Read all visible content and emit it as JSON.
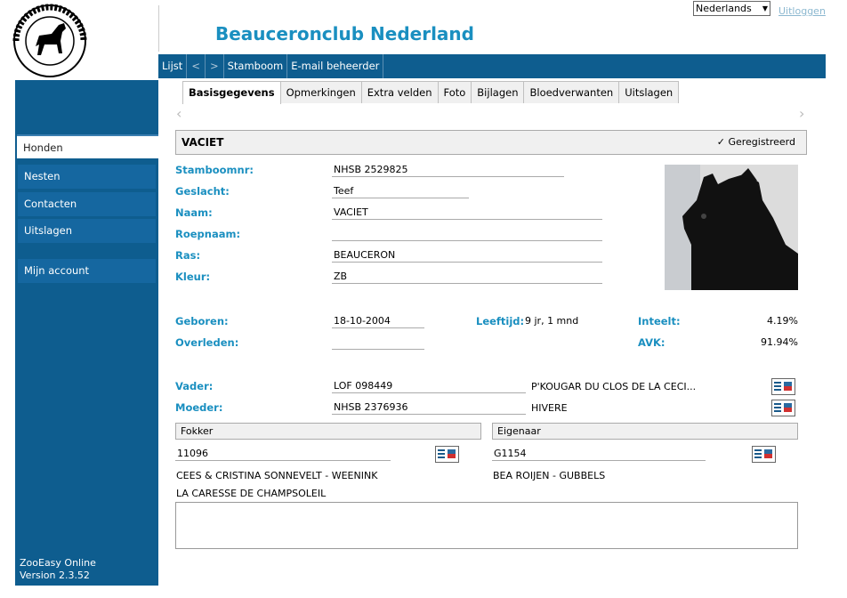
{
  "header": {
    "site_title": "Beauceronclub Nederland",
    "language": "Nederlands",
    "logout": "Uitloggen",
    "logo_text": "NEDERLAND BEAUCERONCLUB"
  },
  "toolbar": {
    "list": "Lijst",
    "prev": "<",
    "next": ">",
    "pedigree": "Stamboom",
    "email_admin": "E-mail beheerder"
  },
  "sidebar": {
    "items": [
      {
        "label": "Honden"
      },
      {
        "label": "Nesten"
      },
      {
        "label": "Contacten"
      },
      {
        "label": "Uitslagen"
      },
      {
        "label": "Mijn account"
      }
    ],
    "footer_line1": "ZooEasy Online",
    "footer_line2": "Version 2.3.52"
  },
  "tabs": [
    {
      "label": "Basisgegevens"
    },
    {
      "label": "Opmerkingen"
    },
    {
      "label": "Extra velden"
    },
    {
      "label": "Foto"
    },
    {
      "label": "Bijlagen"
    },
    {
      "label": "Bloedverwanten"
    },
    {
      "label": "Uitslagen"
    }
  ],
  "dog": {
    "name": "VACIET",
    "status": "✓ Geregistreerd",
    "fields": {
      "stamboomnr_label": "Stamboomnr:",
      "stamboomnr": "NHSB 2529825",
      "geslacht_label": "Geslacht:",
      "geslacht": "Teef",
      "naam_label": "Naam:",
      "naam": "VACIET",
      "roepnaam_label": "Roepnaam:",
      "roepnaam": "",
      "ras_label": "Ras:",
      "ras": "BEAUCERON",
      "kleur_label": "Kleur:",
      "kleur": "ZB",
      "geboren_label": "Geboren:",
      "geboren": "18-10-2004",
      "leeftijd_label": "Leeftijd:",
      "leeftijd": "9 jr, 1 mnd",
      "inteelt_label": "Inteelt:",
      "inteelt": "4.19%",
      "overleden_label": "Overleden:",
      "overleden": "",
      "avk_label": "AVK:",
      "avk": "91.94%",
      "vader_label": "Vader:",
      "vader_nr": "LOF 098449",
      "vader_naam": "P'KOUGAR DU CLOS DE LA CECI...",
      "moeder_label": "Moeder:",
      "moeder_nr": "NHSB 2376936",
      "moeder_naam": "HIVERE"
    }
  },
  "fokker": {
    "title": "Fokker",
    "nr": "11096",
    "name": "CEES & CRISTINA SONNEVELT - WEENINK",
    "kennel": "LA CARESSE DE CHAMPSOLEIL"
  },
  "eigenaar": {
    "title": "Eigenaar",
    "nr": "G1154",
    "name": "BEA ROIJEN - GUBBELS"
  },
  "colors": {
    "accent": "#1a8fc0",
    "nav": "#0e5d8f"
  }
}
